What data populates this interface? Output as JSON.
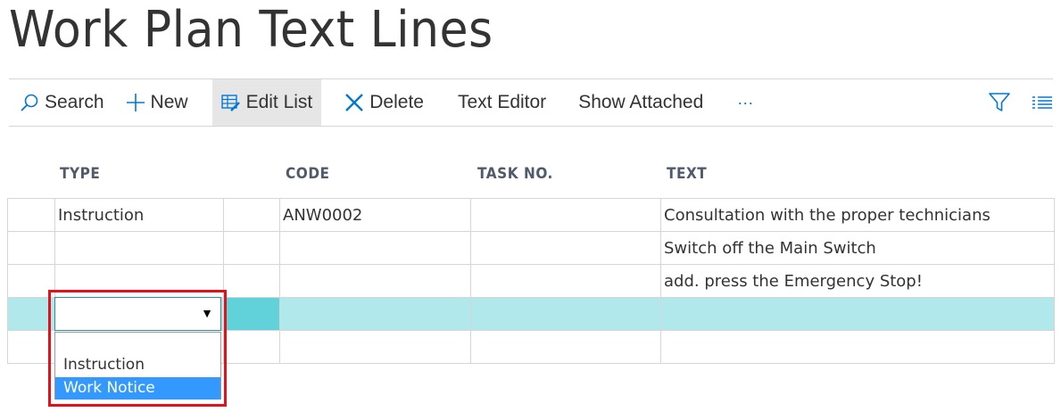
{
  "page": {
    "title": "Work Plan Text Lines"
  },
  "toolbar": {
    "search_label": "Search",
    "new_label": "New",
    "edit_list_label": "Edit List",
    "delete_label": "Delete",
    "text_editor_label": "Text Editor",
    "show_attached_label": "Show Attached",
    "more_label": "···",
    "accent_color": "#0078d4"
  },
  "grid": {
    "columns": [
      "TYPE",
      "CODE",
      "TASK NO.",
      "TEXT"
    ],
    "rows": [
      {
        "type": "Instruction",
        "code": "ANW0002",
        "task_no": "",
        "text": "Consultation with the proper technicians"
      },
      {
        "type": "",
        "code": "",
        "task_no": "",
        "text": "Switch off the Main Switch"
      },
      {
        "type": "",
        "code": "",
        "task_no": "",
        "text": "add. press the Emergency Stop!"
      },
      {
        "type": "",
        "code": "",
        "task_no": "",
        "text": "",
        "selected": true
      },
      {
        "type": "",
        "code": "",
        "task_no": "",
        "text": ""
      }
    ]
  },
  "dropdown": {
    "value": "",
    "arrow": "▼",
    "options": [
      "Instruction",
      "Work Notice"
    ],
    "highlighted": "Work Notice"
  }
}
